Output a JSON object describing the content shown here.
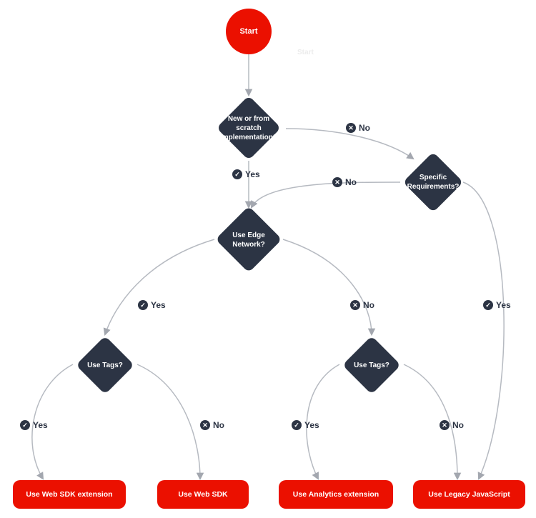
{
  "yes": "Yes",
  "no": "No",
  "nodes": {
    "start": "Start",
    "ghost": "Start",
    "q1": "New or from scratch implementation?",
    "q_spec": "Specific Requirements?",
    "q_edge": "Use Edge Network?",
    "q_tags_l": "Use Tags?",
    "q_tags_r": "Use Tags?",
    "out1": "Use Web SDK extension",
    "out2": "Use Web SDK",
    "out3": "Use Analytics extension",
    "out4": "Use Legacy JavaScript"
  },
  "chart_data": {
    "type": "flowchart",
    "title": "",
    "nodes": [
      {
        "id": "start",
        "type": "start",
        "label": "Start"
      },
      {
        "id": "q1",
        "type": "decision",
        "label": "New or from scratch implementation?"
      },
      {
        "id": "q_spec",
        "type": "decision",
        "label": "Specific Requirements?"
      },
      {
        "id": "q_edge",
        "type": "decision",
        "label": "Use Edge Network?"
      },
      {
        "id": "q_tags_l",
        "type": "decision",
        "label": "Use Tags?"
      },
      {
        "id": "q_tags_r",
        "type": "decision",
        "label": "Use Tags?"
      },
      {
        "id": "out1",
        "type": "terminal",
        "label": "Use Web SDK extension"
      },
      {
        "id": "out2",
        "type": "terminal",
        "label": "Use Web SDK"
      },
      {
        "id": "out3",
        "type": "terminal",
        "label": "Use Analytics extension"
      },
      {
        "id": "out4",
        "type": "terminal",
        "label": "Use Legacy JavaScript"
      }
    ],
    "edges": [
      {
        "from": "start",
        "to": "q1",
        "label": null
      },
      {
        "from": "q1",
        "to": "q_edge",
        "label": "Yes"
      },
      {
        "from": "q1",
        "to": "q_spec",
        "label": "No"
      },
      {
        "from": "q_spec",
        "to": "q_edge",
        "label": "No"
      },
      {
        "from": "q_spec",
        "to": "out4",
        "label": "Yes"
      },
      {
        "from": "q_edge",
        "to": "q_tags_l",
        "label": "Yes"
      },
      {
        "from": "q_edge",
        "to": "q_tags_r",
        "label": "No"
      },
      {
        "from": "q_tags_l",
        "to": "out1",
        "label": "Yes"
      },
      {
        "from": "q_tags_l",
        "to": "out2",
        "label": "No"
      },
      {
        "from": "q_tags_r",
        "to": "out3",
        "label": "Yes"
      },
      {
        "from": "q_tags_r",
        "to": "out4",
        "label": "No"
      }
    ]
  }
}
